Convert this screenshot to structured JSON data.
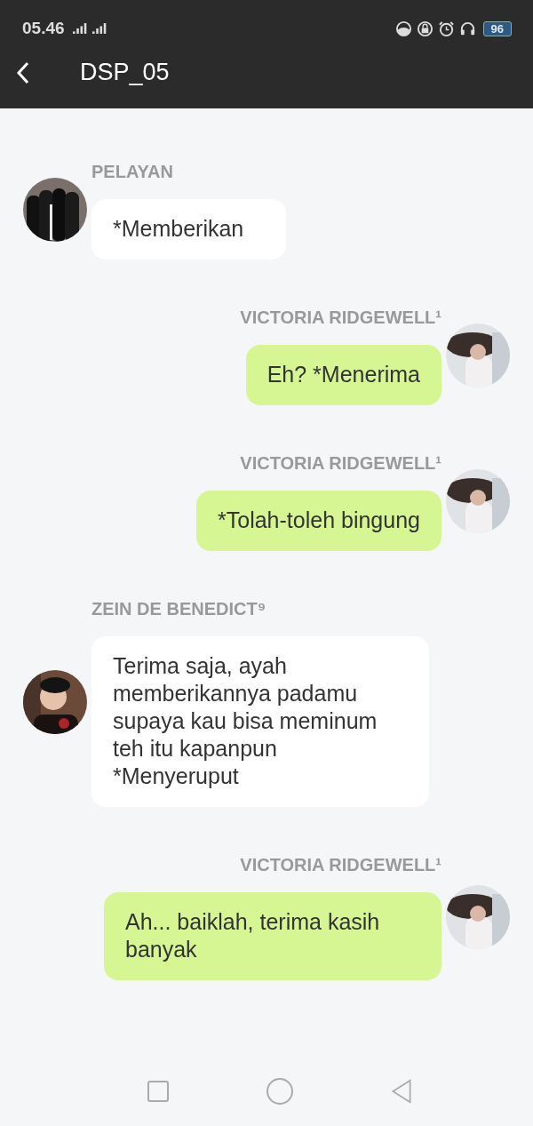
{
  "status_bar": {
    "time": "05.46",
    "battery": "96"
  },
  "header": {
    "title": "DSP_05"
  },
  "messages": [
    {
      "kind": "incoming",
      "sender": "PELAYAN",
      "text": "*Memberikan"
    },
    {
      "kind": "outgoing",
      "sender": "VICTORIA RIDGEWELL¹",
      "text": "Eh? *Menerima"
    },
    {
      "kind": "outgoing",
      "sender": "VICTORIA RIDGEWELL¹",
      "text": "*Tolah-toleh bingung"
    },
    {
      "kind": "incoming",
      "sender": "ZEIN DE BENEDICT⁹",
      "text": "Terima saja, ayah memberikannya padamu supaya kau bisa meminum teh itu kapanpun *Menyeruput"
    },
    {
      "kind": "outgoing",
      "sender": "VICTORIA RIDGEWELL¹",
      "text": "Ah... baiklah, terima kasih banyak"
    }
  ]
}
